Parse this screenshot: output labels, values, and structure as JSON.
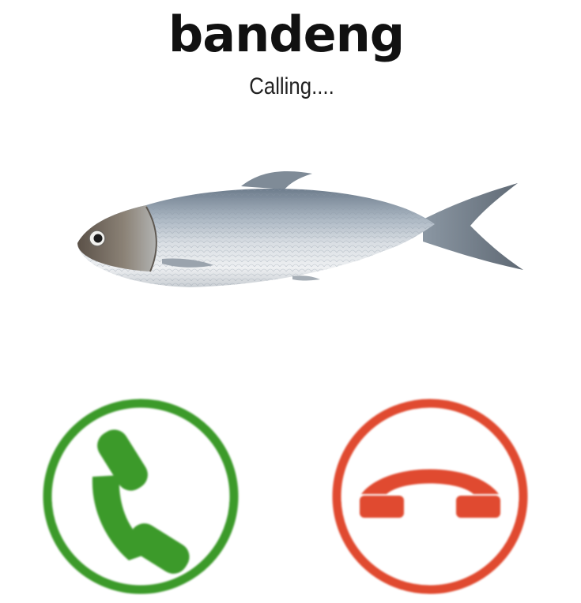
{
  "caller": {
    "name": "bandeng",
    "status": "Calling...."
  },
  "photo": {
    "subject": "milkfish"
  },
  "actions": {
    "accept": {
      "icon": "phone-handset-icon",
      "color": "#3c9a2a"
    },
    "decline": {
      "icon": "hang-up-icon",
      "color": "#e04a30"
    }
  }
}
